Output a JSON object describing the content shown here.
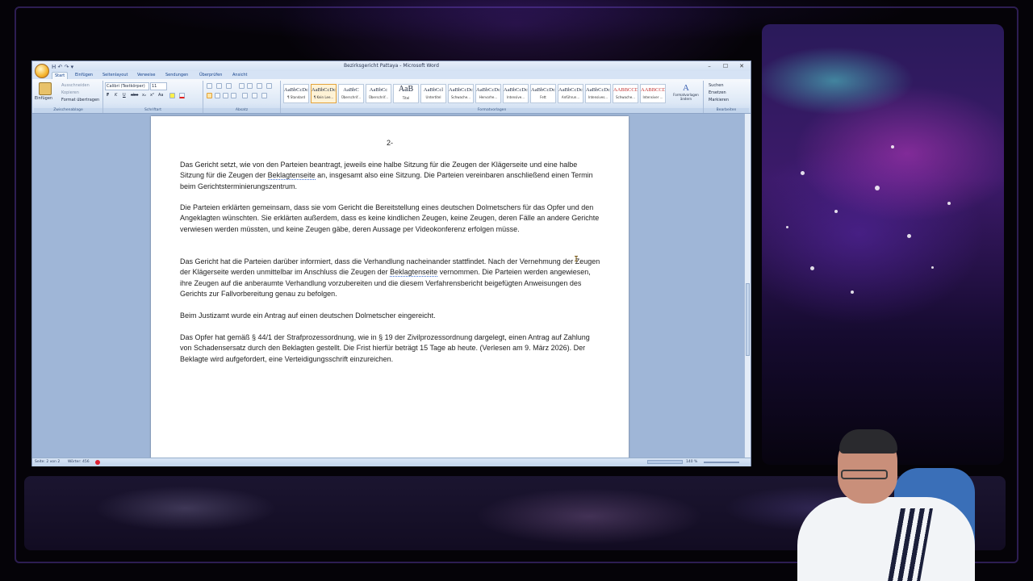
{
  "word": {
    "title": "Bezirksgericht Pattaya - Microsoft Word",
    "qat": "H ↶ ↷ ▾",
    "window_controls": [
      "–",
      "☐",
      "✕"
    ],
    "tabs": [
      "Start",
      "Einfügen",
      "Seitenlayout",
      "Verweise",
      "Sendungen",
      "Überprüfen",
      "Ansicht"
    ],
    "clipboard": {
      "paste": "Einfügen",
      "cut": "Ausschneiden",
      "copy": "Kopieren",
      "format_painter": "Format übertragen",
      "label": "Zwischenablage"
    },
    "font": {
      "name": "Calibri (Textkörper)",
      "size": "11",
      "buttons": [
        "F",
        "K",
        "U",
        "abe",
        "x₂",
        "x²",
        "Aa"
      ],
      "label": "Schriftart"
    },
    "paragraph": {
      "label": "Absatz"
    },
    "styles": {
      "items": [
        {
          "sample": "AaBbCcDc",
          "name": "¶ Standard"
        },
        {
          "sample": "AaBbCcDc",
          "name": "¶ Kein Lee..."
        },
        {
          "sample": "AaBbC",
          "name": "Überschrif..."
        },
        {
          "sample": "AaBbCc",
          "name": "Überschrif..."
        },
        {
          "sample": "AaB",
          "name": "Titel"
        },
        {
          "sample": "AaBbCcl",
          "name": "Untertitel"
        },
        {
          "sample": "AaBbCcDc",
          "name": "Schwache..."
        },
        {
          "sample": "AaBbCcDc",
          "name": "Hervorhe..."
        },
        {
          "sample": "AaBbCcDc",
          "name": "Intensive..."
        },
        {
          "sample": "AaBbCcDc",
          "name": "Fett"
        },
        {
          "sample": "AaBbCcDc",
          "name": "Anführun..."
        },
        {
          "sample": "AaBbCcDc",
          "name": "Intensives..."
        },
        {
          "sample": "AABBCCDC",
          "name": "Schwache..."
        },
        {
          "sample": "AABBCCDC",
          "name": "Intensiver ..."
        }
      ],
      "change_styles": "Formatvorlagen ändern",
      "label": "Formatvorlagen"
    },
    "editing": {
      "find": "Suchen",
      "replace": "Ersetzen",
      "select": "Markieren",
      "label": "Bearbeiten"
    },
    "document": {
      "page_number": "2-",
      "paragraphs": [
        {
          "parts": [
            "Das Gericht setzt, wie von den Parteien beantragt, jeweils eine halbe Sitzung für die Zeugen der Klägerseite und eine halbe Sitzung für die Zeugen der ",
            "Beklagtenseite",
            " an, insgesamt also eine Sitzung. Die Parteien vereinbaren anschließend einen Termin beim Gerichtsterminierungszentrum."
          ]
        },
        {
          "text": "Die Parteien erklärten gemeinsam, dass sie vom Gericht die Bereitstellung eines deutschen Dolmetschers für das Opfer und den Angeklagten wünschten. Sie erklärten außerdem, dass es keine kindlichen Zeugen, keine Zeugen, deren Fälle an andere Gerichte verwiesen werden müssten, und keine Zeugen gäbe, deren Aussage per Videokonferenz erfolgen müsse."
        },
        {
          "parts": [
            "Das Gericht hat die Parteien darüber informiert, dass die Verhandlung nacheinander stattfindet. Nach der Vernehmung der Zeugen der Klägerseite werden unmittelbar im Anschluss die Zeugen der ",
            "Beklagtenseite",
            " vernommen. Die Parteien werden angewiesen, ihre Zeugen auf die anberaumte Verhandlung vorzubereiten und die diesem Verfahrensbericht beigefügten Anweisungen des Gerichts zur Fallvorbereitung genau zu befolgen."
          ]
        },
        {
          "text": "Beim Justizamt wurde ein Antrag auf einen deutschen Dolmetscher eingereicht."
        },
        {
          "text": "Das Opfer hat gemäß § 44/1 der Strafprozessordnung, wie in § 19 der Zivilprozessordnung dargelegt, einen Antrag auf Zahlung von Schadensersatz durch den Beklagten gestellt. Die Frist hierfür beträgt 15 Tage ab heute. (Verlesen am 9. März 2026). Der Beklagte wird aufgefordert, eine Verteidigungsschrift einzureichen."
        }
      ]
    },
    "status": {
      "page": "Seite: 2 von 2",
      "words": "Wörter: 456",
      "zoom": "140 %"
    }
  }
}
